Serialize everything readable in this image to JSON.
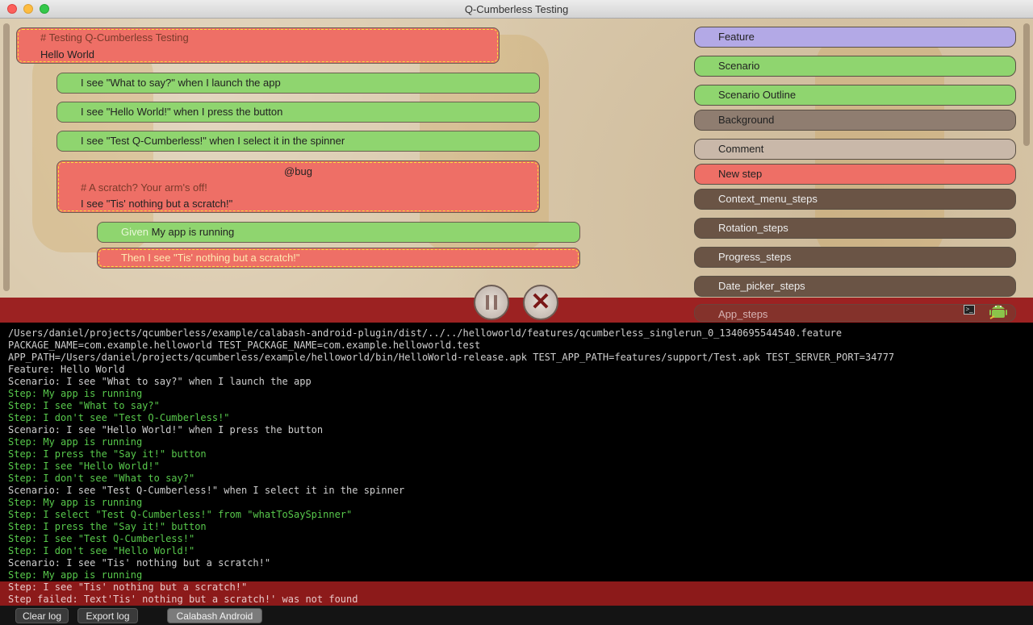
{
  "window": {
    "title": "Q-Cumberless Testing"
  },
  "editor": {
    "feature_block": {
      "comment": "# Testing Q-Cumberless Testing",
      "title": "Hello World"
    },
    "scenarios": [
      {
        "text": "I see \"What to say?\" when I launch the app"
      },
      {
        "text": "I see \"Hello World!\" when I press the button"
      },
      {
        "text": "I see \"Test Q-Cumberless!\" when I select it in the spinner"
      }
    ],
    "failed_scenario": {
      "tag": "@bug",
      "comment": "# A scratch? Your arm's off!",
      "title": "I see \"Tis' nothing but a scratch!\""
    },
    "steps": [
      {
        "keyword": "Given",
        "text": "My app is running"
      },
      {
        "keyword": "Then",
        "text": "I see \"Tis' nothing but a scratch!\""
      }
    ]
  },
  "palette": [
    {
      "label": "Feature",
      "color": "#b3a9e6"
    },
    {
      "label": "Scenario",
      "color": "#8fd56f"
    },
    {
      "label": "Scenario Outline",
      "color": "#8fd56f"
    },
    {
      "label": "Background",
      "color": "#8f7d70"
    },
    {
      "label": "Comment",
      "color": "#c9b8a9"
    },
    {
      "label": "New step",
      "color": "#ee6f66"
    },
    {
      "label": "Context_menu_steps",
      "color": "#6a5445"
    },
    {
      "label": "Rotation_steps",
      "color": "#6a5445"
    },
    {
      "label": "Progress_steps",
      "color": "#6a5445"
    },
    {
      "label": "Date_picker_steps",
      "color": "#6a5445"
    },
    {
      "label": "App_steps",
      "color": "#6a5445"
    }
  ],
  "controls": {
    "pause_icon": "pause-icon",
    "stop_icon": "stop-icon",
    "terminal_icon": "terminal-icon",
    "android_icon": "android-icon"
  },
  "log": [
    {
      "text": "/Users/daniel/projects/qcumberless/example/calabash-android-plugin/dist/../../helloworld/features/qcumberless_singlerun_0_1340695544540.feature",
      "kind": "info"
    },
    {
      "text": "PACKAGE_NAME=com.example.helloworld TEST_PACKAGE_NAME=com.example.helloworld.test",
      "kind": "info"
    },
    {
      "text": "APP_PATH=/Users/daniel/projects/qcumberless/example/helloworld/bin/HelloWorld-release.apk TEST_APP_PATH=features/support/Test.apk TEST_SERVER_PORT=34777",
      "kind": "info"
    },
    {
      "text": "Feature: Hello World",
      "kind": "info"
    },
    {
      "text": "Scenario: I see \"What to say?\" when I launch the app",
      "kind": "info"
    },
    {
      "text": "Step: My app is running",
      "kind": "pass"
    },
    {
      "text": "Step: I see \"What to say?\"",
      "kind": "pass"
    },
    {
      "text": "Step: I don't see \"Test Q-Cumberless!\"",
      "kind": "pass"
    },
    {
      "text": "Scenario: I see \"Hello World!\" when I press the button",
      "kind": "info"
    },
    {
      "text": "Step: My app is running",
      "kind": "pass"
    },
    {
      "text": "Step: I press the \"Say it!\" button",
      "kind": "pass"
    },
    {
      "text": "Step: I see \"Hello World!\"",
      "kind": "pass"
    },
    {
      "text": "Step: I don't see \"What to say?\"",
      "kind": "pass"
    },
    {
      "text": "Scenario: I see \"Test Q-Cumberless!\" when I select it in the spinner",
      "kind": "info"
    },
    {
      "text": "Step: My app is running",
      "kind": "pass"
    },
    {
      "text": "Step: I select \"Test Q-Cumberless!\" from \"whatToSaySpinner\"",
      "kind": "pass"
    },
    {
      "text": "Step: I press the \"Say it!\" button",
      "kind": "pass"
    },
    {
      "text": "Step: I see \"Test Q-Cumberless!\"",
      "kind": "pass"
    },
    {
      "text": "Step: I don't see \"Hello World!\"",
      "kind": "pass"
    },
    {
      "text": "Scenario: I see \"Tis' nothing but a scratch!\"",
      "kind": "info"
    },
    {
      "text": "Step: My app is running",
      "kind": "pass"
    },
    {
      "text": "Step: I see \"Tis' nothing but a scratch!\"",
      "kind": "fail"
    },
    {
      "text": "Step failed: Text'Tis' nothing but a scratch!' was not found",
      "kind": "fail"
    }
  ],
  "bottom": {
    "clear_label": "Clear log",
    "export_label": "Export log",
    "device_label": "Calabash Android"
  }
}
